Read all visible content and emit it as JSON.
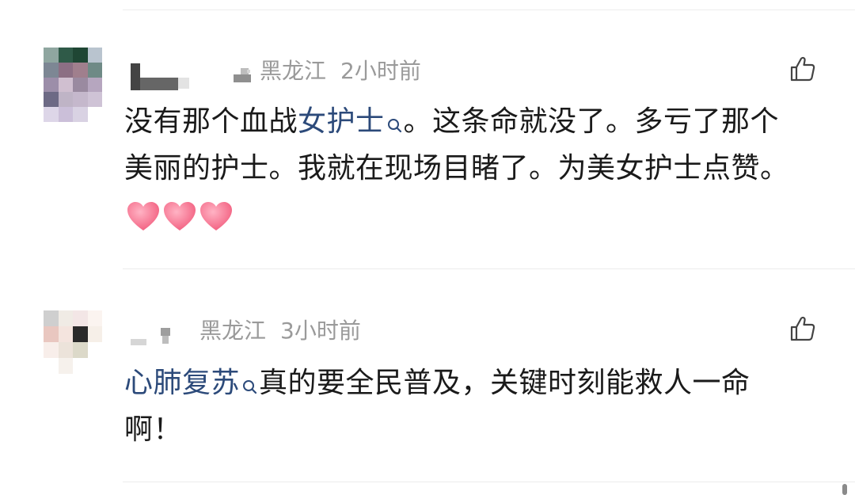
{
  "comments": [
    {
      "location": "黑龙江",
      "time": "2小时前",
      "text_before": "没有那个血战",
      "link": "女护士",
      "text_after": "。这条命就没了。多亏了那个美丽的护士。我就在现场目睹了。为美女护士点赞。",
      "emoji": [
        "heart-emoji",
        "heart-emoji",
        "heart-emoji"
      ],
      "like_icon": "thumbs-up-icon"
    },
    {
      "location": "黑龙江",
      "time": "3小时前",
      "text_before": "",
      "link": "心肺复苏",
      "text_after": "真的要全民普及，关键时刻能救人一命啊！",
      "like_icon": "thumbs-up-icon"
    }
  ],
  "colors": {
    "link": "#2c4a7a",
    "meta": "#9a9a9a",
    "text": "#1a1a1a",
    "divider": "#ececec"
  }
}
